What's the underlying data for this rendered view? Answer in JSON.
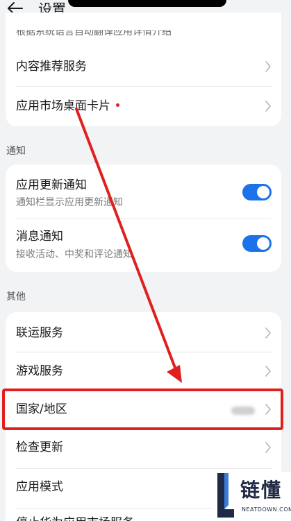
{
  "header": {
    "title": "设置"
  },
  "card_top": {
    "partial_text": "根据系统语言自动翻译应用详情介绍",
    "items": [
      {
        "label": "内容推荐服务"
      },
      {
        "label": "应用市场桌面卡片",
        "has_red_dot": true
      }
    ]
  },
  "notification": {
    "section_title": "通知",
    "items": [
      {
        "label": "应用更新通知",
        "sub": "通知栏显示应用更新通知",
        "toggle": true
      },
      {
        "label": "消息通知",
        "sub": "接收活动、中奖和评论通知",
        "toggle": true
      }
    ]
  },
  "other": {
    "section_title": "其他",
    "items": [
      {
        "label": "联运服务"
      },
      {
        "label": "游戏服务"
      },
      {
        "label": "国家/地区",
        "value": "(blurred)"
      },
      {
        "label": "检查更新"
      },
      {
        "label": "应用模式"
      },
      {
        "label": "停止华为应用市场服务"
      }
    ]
  },
  "watermark": {
    "text": "链懂",
    "sub": "NEATDOWN.COM"
  },
  "colors": {
    "accent": "#1a73e8",
    "annotation_red": "#e0201f",
    "background": "#f1f3f5"
  }
}
